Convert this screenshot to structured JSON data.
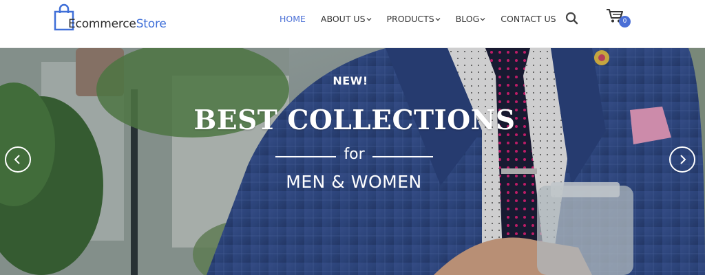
{
  "brand": {
    "name_part1": "Ecommerce",
    "name_part2": "Store",
    "accent": "#4a6fd6"
  },
  "nav": {
    "items": [
      {
        "label": "HOME",
        "active": true,
        "dropdown": false
      },
      {
        "label": "ABOUT US",
        "active": false,
        "dropdown": true
      },
      {
        "label": "PRODUCTS",
        "active": false,
        "dropdown": true
      },
      {
        "label": "BLOG",
        "active": false,
        "dropdown": true
      },
      {
        "label": "CONTACT US",
        "active": false,
        "dropdown": false
      }
    ]
  },
  "header_icons": {
    "search": "search-icon",
    "cart": "cart-icon",
    "cart_count": "0"
  },
  "hero": {
    "badge": "NEW!",
    "title": "BEST COLLECTIONS",
    "connector": "for",
    "subtitle": "MEN & WOMEN",
    "prev_icon": "chevron-left-icon",
    "next_icon": "chevron-right-icon"
  }
}
